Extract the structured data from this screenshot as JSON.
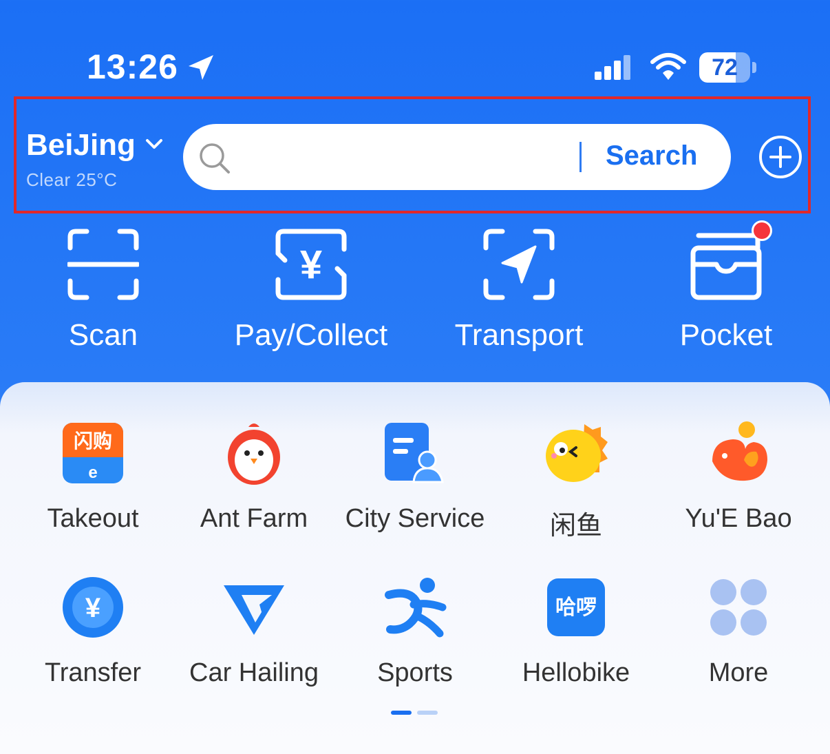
{
  "status_bar": {
    "time": "13:26",
    "battery": "72",
    "battery_level": 0.72,
    "icons": [
      "location-arrow-icon",
      "signal-icon",
      "wifi-icon",
      "battery-icon"
    ]
  },
  "header": {
    "city": "BeiJing",
    "weather": "Clear 25°C",
    "search_button": "Search",
    "icons": [
      "chevron-down-icon",
      "search-icon",
      "plus-icon"
    ]
  },
  "quick_actions": [
    {
      "label": "Scan",
      "icon": "scan-icon"
    },
    {
      "label": "Pay/Collect",
      "icon": "yuan-scan-icon"
    },
    {
      "label": "Transport",
      "icon": "navigation-arrow-icon"
    },
    {
      "label": "Pocket",
      "icon": "wallet-icon"
    }
  ],
  "apps_row1": [
    {
      "label": "Takeout",
      "icon": "takeout-icon"
    },
    {
      "label": "Ant Farm",
      "icon": "chick-icon"
    },
    {
      "label": "City Service",
      "icon": "city-service-icon"
    },
    {
      "label": "闲鱼",
      "icon": "fish-icon"
    },
    {
      "label": "Yu'E Bao",
      "icon": "whale-icon"
    }
  ],
  "apps_row2": [
    {
      "label": "Transfer",
      "icon": "transfer-icon"
    },
    {
      "label": "Car Hailing",
      "icon": "car-hailing-icon"
    },
    {
      "label": "Sports",
      "icon": "sports-icon"
    },
    {
      "label": "Hellobike",
      "icon": "hellobike-icon"
    },
    {
      "label": "More",
      "icon": "more-grid-icon"
    }
  ],
  "icon_texts": {
    "takeout": "闪购",
    "takeout_sub": "e",
    "hellobike": "哈啰",
    "yuan": "¥"
  },
  "colors": {
    "brand_blue": "#1b6ff5",
    "highlight_red": "#e0282a",
    "badge_red": "#f5343b"
  },
  "pager": {
    "pages": 2,
    "current": 1
  }
}
